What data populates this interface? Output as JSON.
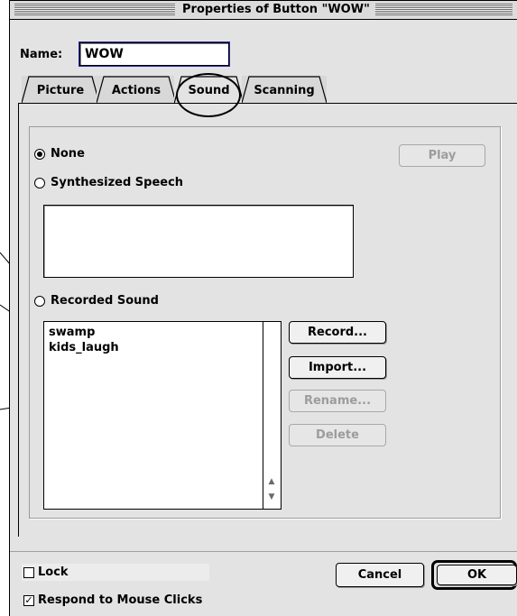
{
  "window": {
    "title": "Properties of Button \"WOW\""
  },
  "name_field": {
    "label": "Name:",
    "value": "WOW"
  },
  "tabs": [
    {
      "label": "Picture"
    },
    {
      "label": "Actions"
    },
    {
      "label": "Sound",
      "selected": true
    },
    {
      "label": "Scanning"
    }
  ],
  "sound": {
    "options": [
      {
        "label": "None",
        "selected": true
      },
      {
        "label": "Synthesized Speech",
        "selected": false
      },
      {
        "label": "Recorded Sound",
        "selected": false
      }
    ],
    "play_label": "Play",
    "speech_text": "",
    "recorded_sounds": [
      "swamp",
      "kids_laugh"
    ],
    "buttons": {
      "record": "Record...",
      "import": "Import...",
      "rename": "Rename...",
      "delete": "Delete"
    }
  },
  "footer": {
    "lock_label": "Lock",
    "lock_checked": false,
    "respond_label": "Respond to Mouse Clicks",
    "respond_checked": true,
    "cancel_label": "Cancel",
    "ok_label": "OK"
  }
}
